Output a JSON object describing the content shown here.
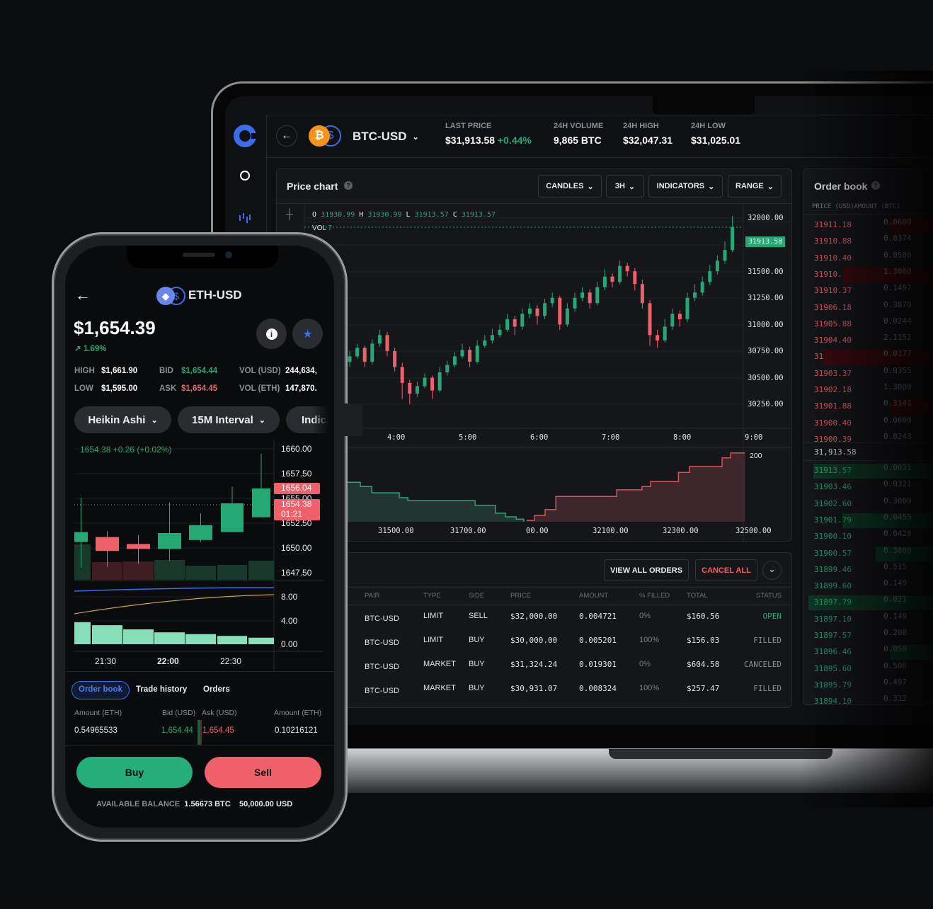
{
  "colors": {
    "green": "#26a874",
    "red": "#f0606b",
    "blue": "#3b6de8",
    "bg": "#0f1013",
    "panel": "#15161a"
  },
  "desktop": {
    "sidebar": {
      "icons": [
        "logo-icon",
        "portfolio-icon",
        "trade-icon"
      ]
    },
    "header": {
      "back_icon": "arrow-left-icon",
      "pair": "BTC-USD",
      "stats": [
        {
          "label": "LAST PRICE",
          "value": "$31,913.58",
          "change": "+0.44%"
        },
        {
          "label": "24H VOLUME",
          "value": "9,865 BTC"
        },
        {
          "label": "24H HIGH",
          "value": "$32,047.31"
        },
        {
          "label": "24H LOW",
          "value": "$31,025.01"
        }
      ]
    },
    "price_chart": {
      "title": "Price chart",
      "controls": [
        "CANDLES",
        "3H",
        "INDICATORS",
        "RANGE"
      ],
      "ohlc": {
        "o_label": "O",
        "o": "31930.99",
        "h_label": "H",
        "h": "31930.99",
        "l_label": "L",
        "l": "31913.57",
        "c_label": "C",
        "c": "31913.57"
      },
      "vol_label": "VOL",
      "vol": "7",
      "last_price_tag": "31913.58",
      "price_ticks": [
        "32000.00",
        "31500.00",
        "31250.00",
        "31000.00",
        "30750.00",
        "30500.00",
        "30250.00"
      ],
      "time_ticks": [
        "4:00",
        "5:00",
        "6:00",
        "7:00",
        "8:00",
        "9:00"
      ],
      "depth_ticks": [
        "31500.00",
        "31700.00",
        "00.00",
        "32100.00",
        "32300.00",
        "32500.00"
      ],
      "depth_y_tick": "200"
    },
    "order_book": {
      "title": "Order book",
      "col_price": "PRICE (USD)",
      "col_amount": "AMOUNT (BTC)",
      "mid": "31,913.58",
      "asks": [
        [
          "31911.18",
          "0.0600"
        ],
        [
          "31910.88",
          "0.0374"
        ],
        [
          "31910.40",
          "0.0500"
        ],
        [
          "31910.",
          "1.3000"
        ],
        [
          "31910.37",
          "0.1497"
        ],
        [
          "31906.18",
          "0.3870"
        ],
        [
          "31905.88",
          "0.0244"
        ],
        [
          "31904.40",
          "2.1152"
        ],
        [
          "31",
          "0.0177"
        ],
        [
          "31903.37",
          "0.0355"
        ],
        [
          "31902.18",
          "1.3000"
        ],
        [
          "31901.88",
          "0.3141"
        ],
        [
          "31900.40",
          "0.0600"
        ],
        [
          "31900.39",
          "0.0243"
        ]
      ],
      "bids": [
        [
          "31913.57",
          "0.0031"
        ],
        [
          "31903.46",
          "0.0321"
        ],
        [
          "31902.60",
          "0.3000"
        ],
        [
          "31901.79",
          "0.0455"
        ],
        [
          "31900.10",
          "0.0428"
        ],
        [
          "31900.57",
          "0.3000"
        ],
        [
          "31899.46",
          "0.515"
        ],
        [
          "31899.60",
          "0.149"
        ],
        [
          "31897.79",
          "0.021"
        ],
        [
          "31897.10",
          "0.149"
        ],
        [
          "31897.57",
          "0.200"
        ],
        [
          "31896.46",
          "0.050"
        ],
        [
          "31895.60",
          "0.506"
        ],
        [
          "31895.79",
          "0.497"
        ],
        [
          "31894.10",
          "0.312"
        ]
      ]
    },
    "orders": {
      "view_all": "VIEW ALL ORDERS",
      "cancel_all": "CANCEL ALL",
      "columns": [
        "PAIR",
        "TYPE",
        "SIDE",
        "PRICE",
        "AMOUNT",
        "% FILLED",
        "TOTAL",
        "STATUS"
      ],
      "rows": [
        [
          "BTC-USD",
          "LIMIT",
          "SELL",
          "$32,000.00",
          "0.004721",
          "0%",
          "$160.56",
          "OPEN"
        ],
        [
          "BTC-USD",
          "LIMIT",
          "BUY",
          "$30,000.00",
          "0.005201",
          "100%",
          "$156.03",
          "FILLED"
        ],
        [
          "BTC-USD",
          "MARKET",
          "BUY",
          "$31,324.24",
          "0.019301",
          "0%",
          "$604.58",
          "CANCELED"
        ],
        [
          "BTC-USD",
          "MARKET",
          "BUY",
          "$30,931.07",
          "0.008324",
          "100%",
          "$257.47",
          "FILLED"
        ]
      ]
    }
  },
  "mobile": {
    "pair": "ETH-USD",
    "price": "$1,654.39",
    "change": "1.69%",
    "stats": {
      "high_label": "HIGH",
      "high": "$1,661.90",
      "low_label": "LOW",
      "low": "$1,595.00",
      "bid_label": "BID",
      "bid": "$1,654.44",
      "ask_label": "ASK",
      "ask": "$1,654.45",
      "vol_usd_label": "VOL (USD)",
      "vol_usd": "244,634,",
      "vol_eth_label": "VOL (ETH)",
      "vol_eth": "147,870."
    },
    "pills": [
      "Heikin Ashi",
      "15M Interval",
      "Indicators"
    ],
    "chart_header": "1654.38  +0.26 (+0.02%)",
    "price_ticks": [
      "1660.00",
      "1657.50",
      "1655.00",
      "1652.50",
      "1650.00",
      "1647.50"
    ],
    "tag_high": "1656.04",
    "tag_last": "1654.38",
    "tag_timer": "01:21",
    "indicator_ticks": [
      "8.00",
      "4.00",
      "0.00"
    ],
    "time_ticks": [
      "21:30",
      "22:00",
      "22:30"
    ],
    "tabs": [
      "Order book",
      "Trade history",
      "Orders"
    ],
    "ob_headers": [
      "Amount (ETH)",
      "Bid (USD)",
      "Ask (USD)",
      "Amount (ETH)"
    ],
    "ob_row": [
      "0.54965533",
      "1,654.44",
      "1,654.45",
      "0.10216121"
    ],
    "buy": "Buy",
    "sell": "Sell",
    "balance_label": "AVAILABLE BALANCE",
    "balance_btc": "1.56673 BTC",
    "balance_usd": "50,000.00 USD"
  },
  "chart_data": [
    {
      "type": "candlestick",
      "title": "Price chart",
      "ylim": [
        30150,
        32100
      ],
      "x_ticks": [
        "4:00",
        "5:00",
        "6:00",
        "7:00",
        "8:00",
        "9:00"
      ],
      "candles": [
        [
          30650,
          30750,
          30600,
          30700
        ],
        [
          30700,
          30820,
          30680,
          30780
        ],
        [
          30780,
          30800,
          30600,
          30650
        ],
        [
          30650,
          30860,
          30620,
          30820
        ],
        [
          30820,
          30950,
          30790,
          30900
        ],
        [
          30900,
          30930,
          30700,
          30750
        ],
        [
          30750,
          30780,
          30560,
          30600
        ],
        [
          30600,
          30640,
          30300,
          30450
        ],
        [
          30450,
          30480,
          30250,
          30350
        ],
        [
          30350,
          30460,
          30320,
          30420
        ],
        [
          30420,
          30540,
          30400,
          30500
        ],
        [
          30500,
          30520,
          30300,
          30380
        ],
        [
          30380,
          30600,
          30360,
          30550
        ],
        [
          30550,
          30660,
          30520,
          30620
        ],
        [
          30620,
          30740,
          30600,
          30700
        ],
        [
          30700,
          30820,
          30680,
          30760
        ],
        [
          30760,
          30790,
          30600,
          30650
        ],
        [
          30650,
          30850,
          30630,
          30800
        ],
        [
          30800,
          30900,
          30780,
          30850
        ],
        [
          30850,
          30960,
          30820,
          30900
        ],
        [
          30900,
          31000,
          30880,
          30950
        ],
        [
          30950,
          31100,
          30930,
          31050
        ],
        [
          31050,
          31080,
          30900,
          30980
        ],
        [
          30980,
          31150,
          30950,
          31100
        ],
        [
          31100,
          31200,
          31060,
          31150
        ],
        [
          31150,
          31180,
          31000,
          31080
        ],
        [
          31080,
          31240,
          31050,
          31200
        ],
        [
          31200,
          31300,
          31160,
          31250
        ],
        [
          31250,
          31270,
          30950,
          31000
        ],
        [
          31000,
          31200,
          30980,
          31150
        ],
        [
          31150,
          31300,
          31120,
          31250
        ],
        [
          31250,
          31350,
          31220,
          31300
        ],
        [
          31300,
          31330,
          31150,
          31200
        ],
        [
          31200,
          31400,
          31180,
          31350
        ],
        [
          31350,
          31520,
          31320,
          31450
        ],
        [
          31450,
          31480,
          31350,
          31400
        ],
        [
          31400,
          31600,
          31380,
          31550
        ],
        [
          31550,
          31580,
          31450,
          31500
        ],
        [
          31500,
          31530,
          31320,
          31380
        ],
        [
          31380,
          31420,
          31150,
          31200
        ],
        [
          31200,
          31230,
          30800,
          30900
        ],
        [
          30900,
          30950,
          30780,
          30850
        ],
        [
          30850,
          31050,
          30830,
          30980
        ],
        [
          30980,
          31150,
          30950,
          31100
        ],
        [
          31100,
          31130,
          30980,
          31050
        ],
        [
          31050,
          31300,
          31020,
          31250
        ],
        [
          31250,
          31380,
          31220,
          31300
        ],
        [
          31300,
          31450,
          31270,
          31400
        ],
        [
          31400,
          31560,
          31370,
          31500
        ],
        [
          31500,
          31650,
          31470,
          31600
        ],
        [
          31600,
          31780,
          31570,
          31700
        ],
        [
          31700,
          32020,
          31680,
          31913.57
        ]
      ]
    },
    {
      "type": "area",
      "title": "depth",
      "xlim": [
        31362,
        32475
      ],
      "ylim": [
        0,
        200
      ],
      "bids": [
        [
          31362,
          120
        ],
        [
          31399,
          107
        ],
        [
          31431,
          88
        ],
        [
          31508,
          73
        ],
        [
          31532,
          64
        ],
        [
          31720,
          50
        ],
        [
          31777,
          26
        ],
        [
          31805,
          15
        ],
        [
          31835,
          8
        ],
        [
          31856,
          0
        ]
      ],
      "asks": [
        [
          31864,
          4
        ],
        [
          31886,
          19
        ],
        [
          31916,
          37
        ],
        [
          31946,
          77
        ],
        [
          32116,
          97
        ],
        [
          32187,
          107
        ],
        [
          32211,
          122
        ],
        [
          32289,
          150
        ],
        [
          32320,
          168
        ],
        [
          32411,
          194
        ],
        [
          32435,
          209
        ],
        [
          32475,
          209
        ]
      ]
    },
    {
      "type": "candlestick",
      "title": "ETH-USD",
      "ylim": [
        1647,
        1660
      ],
      "candles": [
        [
          1650.6,
          1655.1,
          1648.0,
          1651.6
        ],
        [
          1651.1,
          1651.7,
          1648.1,
          1649.7
        ],
        [
          1650.4,
          1651.3,
          1648.4,
          1649.9
        ],
        [
          1649.9,
          1654.6,
          1648.7,
          1651.5
        ],
        [
          1650.8,
          1653.5,
          1650.6,
          1652.3
        ],
        [
          1651.6,
          1656.2,
          1651.6,
          1654.5
        ],
        [
          1653.1,
          1659.5,
          1653.1,
          1656.0
        ]
      ],
      "indicator_bars": [
        3.7,
        3.2,
        2.5,
        2.0,
        1.7,
        1.4,
        1.1
      ],
      "indicator_ylim": [
        0,
        8
      ]
    }
  ]
}
